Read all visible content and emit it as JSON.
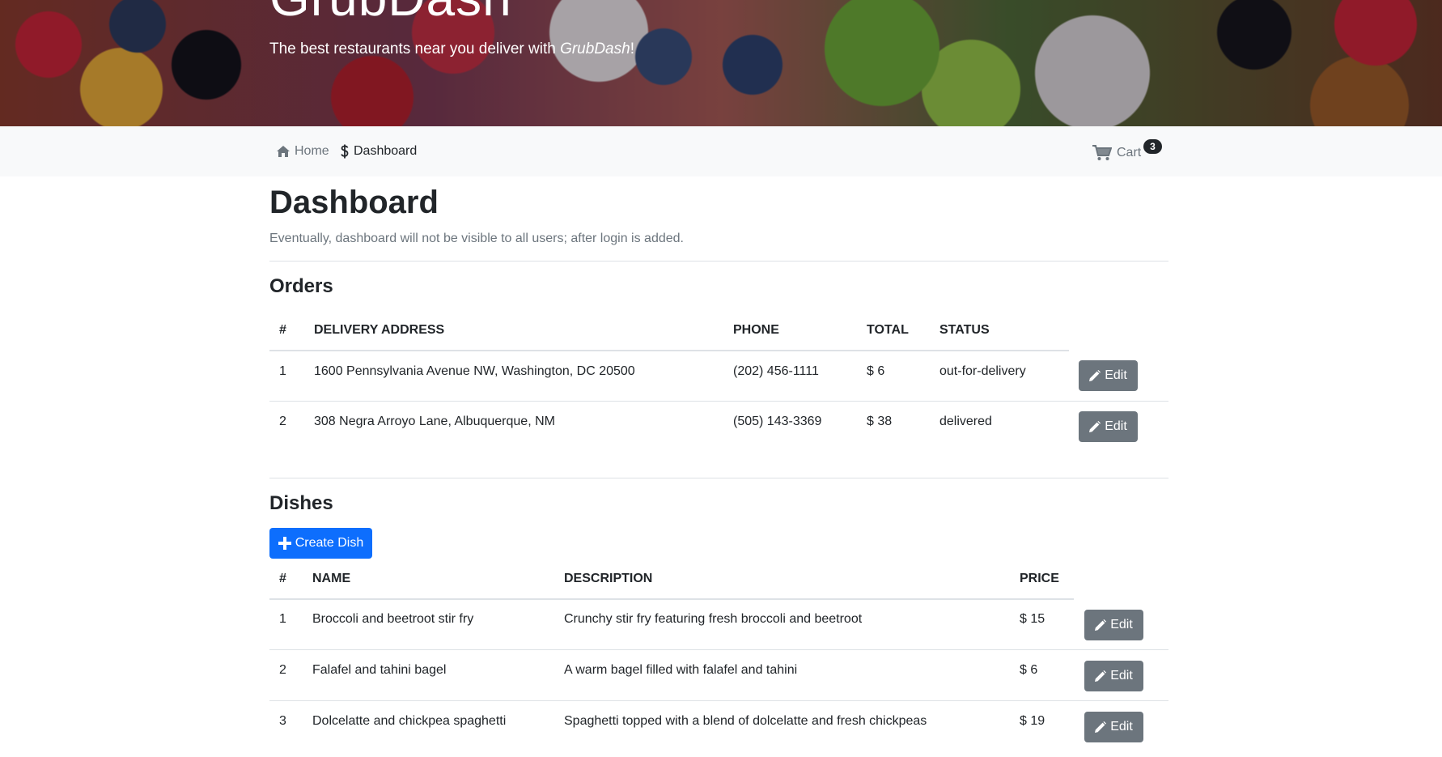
{
  "hero": {
    "title": "GrubDash",
    "tagline_prefix": "The best restaurants near you deliver with ",
    "tagline_brand": "GrubDash",
    "tagline_suffix": "!"
  },
  "nav": {
    "home_label": "Home",
    "dashboard_label": "Dashboard",
    "cart_label": "Cart",
    "cart_count": "3"
  },
  "page": {
    "title": "Dashboard",
    "subtitle": "Eventually, dashboard will not be visible to all users; after login is added."
  },
  "orders": {
    "title": "Orders",
    "columns": [
      "#",
      "DELIVERY ADDRESS",
      "PHONE",
      "TOTAL",
      "STATUS"
    ],
    "rows": [
      {
        "id": "1",
        "address": "1600 Pennsylvania Avenue NW, Washington, DC 20500",
        "phone": "(202) 456-1111",
        "total": "$ 6",
        "status": "out-for-delivery",
        "edit": "Edit"
      },
      {
        "id": "2",
        "address": "308 Negra Arroyo Lane, Albuquerque, NM",
        "phone": "(505) 143-3369",
        "total": "$ 38",
        "status": "delivered",
        "edit": "Edit"
      }
    ]
  },
  "dishes": {
    "title": "Dishes",
    "create_label": "Create Dish",
    "columns": [
      "#",
      "NAME",
      "DESCRIPTION",
      "PRICE"
    ],
    "rows": [
      {
        "id": "1",
        "name": "Broccoli and beetroot stir fry",
        "description": "Crunchy stir fry featuring fresh broccoli and beetroot",
        "price": "$ 15",
        "edit": "Edit"
      },
      {
        "id": "2",
        "name": "Falafel and tahini bagel",
        "description": "A warm bagel filled with falafel and tahini",
        "price": "$ 6",
        "edit": "Edit"
      },
      {
        "id": "3",
        "name": "Dolcelatte and chickpea spaghetti",
        "description": "Spaghetti topped with a blend of dolcelatte and fresh chickpeas",
        "price": "$ 19",
        "edit": "Edit"
      }
    ]
  },
  "colors": {
    "primary": "#0d6efd",
    "secondary": "#6c757d",
    "navbar_bg": "#f8f9fa"
  },
  "icons": {
    "home": "home-icon",
    "dashboard": "dollar-icon",
    "cart": "cart-icon",
    "edit": "pencil-icon",
    "create": "plus-icon"
  }
}
